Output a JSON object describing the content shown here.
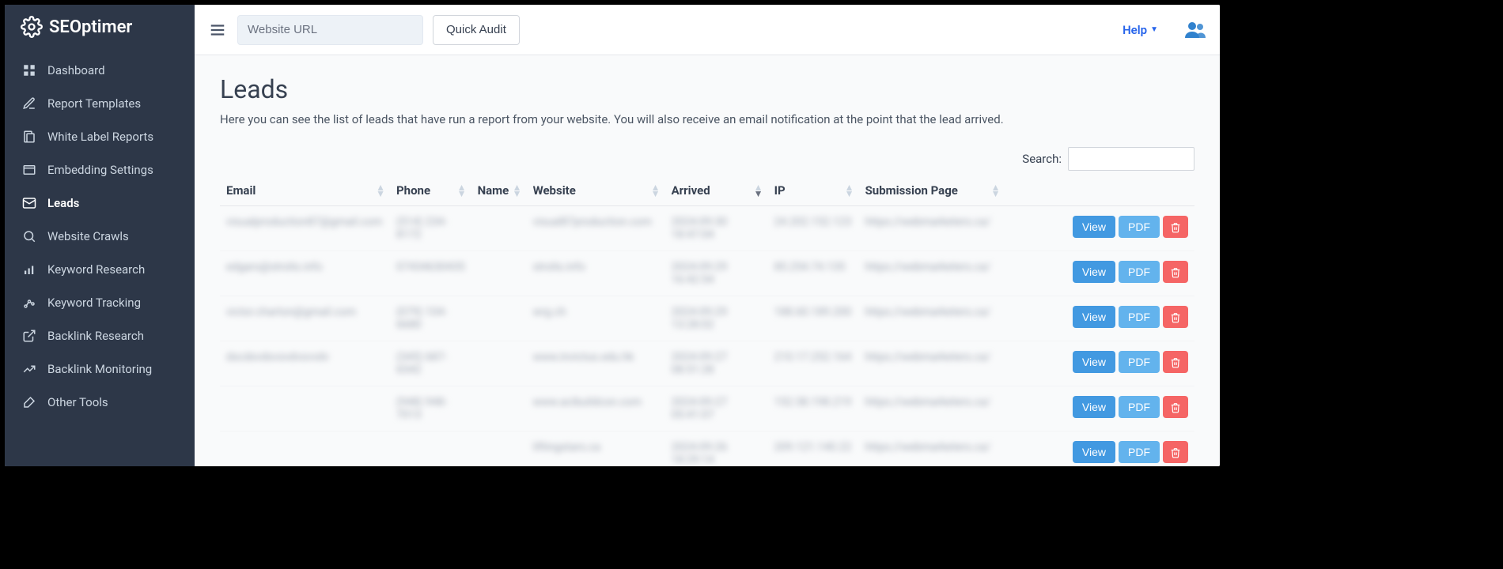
{
  "brand": "SEOptimer",
  "sidebar": {
    "items": [
      {
        "label": "Dashboard",
        "icon": "dashboard"
      },
      {
        "label": "Report Templates",
        "icon": "template"
      },
      {
        "label": "White Label Reports",
        "icon": "report"
      },
      {
        "label": "Embedding Settings",
        "icon": "embed"
      },
      {
        "label": "Leads",
        "icon": "leads",
        "active": true
      },
      {
        "label": "Website Crawls",
        "icon": "crawl"
      },
      {
        "label": "Keyword Research",
        "icon": "keyword"
      },
      {
        "label": "Keyword Tracking",
        "icon": "tracking"
      },
      {
        "label": "Backlink Research",
        "icon": "backlink"
      },
      {
        "label": "Backlink Monitoring",
        "icon": "monitor"
      },
      {
        "label": "Other Tools",
        "icon": "tools"
      }
    ]
  },
  "topbar": {
    "url_placeholder": "Website URL",
    "quick_audit": "Quick Audit",
    "help": "Help"
  },
  "page": {
    "title": "Leads",
    "description": "Here you can see the list of leads that have run a report from your website. You will also receive an email notification at the point that the lead arrived.",
    "search_label": "Search:"
  },
  "table": {
    "columns": [
      "Email",
      "Phone",
      "Name",
      "Website",
      "Arrived",
      "IP",
      "Submission Page",
      ""
    ],
    "view_label": "View",
    "pdf_label": "PDF",
    "rows": [
      {
        "email": "visualproduction87@gmail.com",
        "phone": "(514) 234-8172",
        "name": "",
        "website": "visual87production.com",
        "arrived": "2024-09-30 18:47:04",
        "ip": "24.202.152.123",
        "submission": "https://webmarketers.ca/"
      },
      {
        "email": "edgars@strolis.info",
        "phone": "07434630435",
        "name": "",
        "website": "strolis.info",
        "arrived": "2024-09-29 16:42:54",
        "ip": "85.254.74.135",
        "submission": "https://webmarketers.ca/"
      },
      {
        "email": "victor.charton@gmail.com",
        "phone": "(079) 104-6680",
        "name": "",
        "website": "wrg.ch",
        "arrived": "2024-09-29 13:28:02",
        "ip": "188.60.189.200",
        "submission": "https://webmarketers.ca/"
      },
      {
        "email": "dscdxvdsvsvdvsvvdv",
        "phone": "(345) 687-6542",
        "name": "",
        "website": "www.invictus.edu.hk",
        "arrived": "2024-09-27 08:51:28",
        "ip": "210.17.252.164",
        "submission": "https://webmarketers.ca/"
      },
      {
        "email": "",
        "phone": "(948) 948-7013",
        "name": "",
        "website": "www.acibuildcon.com",
        "arrived": "2024-09-27 05:41:07",
        "ip": "152.58.198.219",
        "submission": "https://webmarketers.ca/"
      },
      {
        "email": "",
        "phone": "",
        "name": "",
        "website": "liftingstars.ca",
        "arrived": "2024-09-26 18:29:14",
        "ip": "209.121.140.22",
        "submission": "https://webmarketers.ca/"
      }
    ]
  }
}
